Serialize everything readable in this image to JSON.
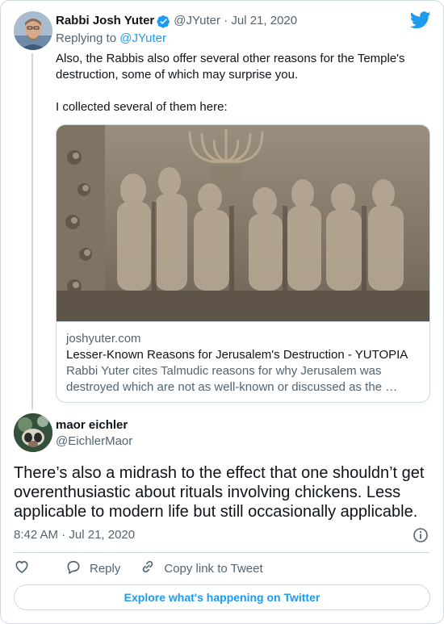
{
  "parent_tweet": {
    "author_name": "Rabbi Josh Yuter",
    "handle": "@JYuter",
    "date": "Jul 21, 2020",
    "replying_prefix": "Replying to ",
    "replying_to": "@JYuter",
    "paragraphs": [
      "Also, the Rabbis also offer several other reasons for the Temple's destruction, some of which may surprise you.",
      "I collected several of them here:"
    ],
    "card": {
      "domain": "joshyuter.com",
      "title": "Lesser-Known Reasons for Jerusalem's Destruction - YUTOPIA",
      "description": "Rabbi Yuter cites Talmudic reasons for why Jerusalem was destroyed which are not as well-known or discussed as the …"
    }
  },
  "main_tweet": {
    "author_name": "maor eichler",
    "handle": "@EichlerMaor",
    "text": "There’s also a midrash to the effect that one shouldn’t get overenthusiastic about rituals involving chickens. Less applicable to modern life but still occasionally applicable.",
    "time": "8:42 AM",
    "separator": " · ",
    "date": "Jul 21, 2020"
  },
  "actions": {
    "reply_label": "Reply",
    "copy_label": "Copy link to Tweet"
  },
  "explore_label": "Explore what's happening on Twitter",
  "icons": {
    "brand": "twitter-bird-icon",
    "verified": "verified-badge-icon",
    "info": "info-icon",
    "like": "heart-icon",
    "reply": "reply-bubble-icon",
    "copy": "link-icon"
  },
  "colors": {
    "accent": "#1d9bf0",
    "text": "#0f1419",
    "muted": "#536471",
    "border": "#cfd9de"
  }
}
